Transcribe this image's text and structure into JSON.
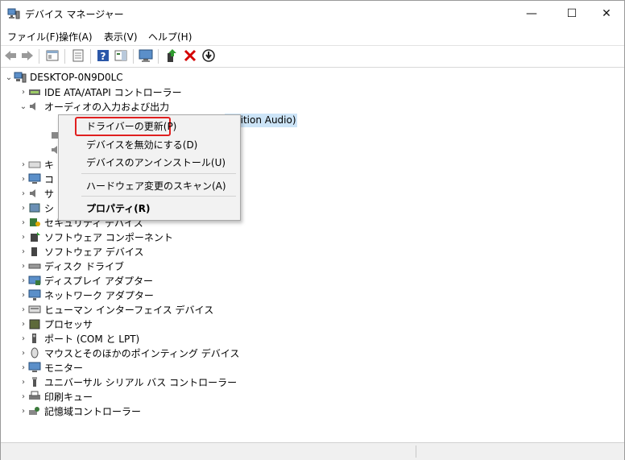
{
  "window": {
    "title": "デバイス マネージャー",
    "minimize": "—",
    "maximize": "☐",
    "close": "✕"
  },
  "menu": [
    "ファイル(F)",
    "操作(A)",
    "表示(V)",
    "ヘルプ(H)"
  ],
  "tree": {
    "root": "DESKTOP-0N9D0LC",
    "items": [
      {
        "label": "IDE ATA/ATAPI コントローラー",
        "icon": "ide-controller-icon",
        "expanded": false
      },
      {
        "label": "オーディオの入力および出力",
        "icon": "audio-icon",
        "expanded": true
      },
      {
        "label": "キ",
        "icon": "keyboard-icon",
        "expanded": false
      },
      {
        "label": "コ",
        "icon": "computer-icon",
        "expanded": false
      },
      {
        "label": "サ",
        "icon": "sound-icon",
        "expanded": false
      },
      {
        "label": "シ",
        "icon": "system-icon",
        "expanded": false
      },
      {
        "label": "セキュリティ デバイス",
        "icon": "security-icon",
        "expanded": false
      },
      {
        "label": "ソフトウェア コンポーネント",
        "icon": "software-component-icon",
        "expanded": false
      },
      {
        "label": "ソフトウェア デバイス",
        "icon": "software-device-icon",
        "expanded": false
      },
      {
        "label": "ディスク ドライブ",
        "icon": "disk-drive-icon",
        "expanded": false
      },
      {
        "label": "ディスプレイ アダプター",
        "icon": "display-adapter-icon",
        "expanded": false
      },
      {
        "label": "ネットワーク アダプター",
        "icon": "network-adapter-icon",
        "expanded": false
      },
      {
        "label": "ヒューマン インターフェイス デバイス",
        "icon": "hid-icon",
        "expanded": false
      },
      {
        "label": "プロセッサ",
        "icon": "processor-icon",
        "expanded": false
      },
      {
        "label": "ポート (COM と LPT)",
        "icon": "port-icon",
        "expanded": false
      },
      {
        "label": "マウスとそのほかのポインティング デバイス",
        "icon": "mouse-icon",
        "expanded": false
      },
      {
        "label": "モニター",
        "icon": "monitor-icon",
        "expanded": false
      },
      {
        "label": "ユニバーサル シリアル バス コントローラー",
        "icon": "usb-icon",
        "expanded": false
      },
      {
        "label": "印刷キュー",
        "icon": "printer-icon",
        "expanded": false
      },
      {
        "label": "記憶域コントローラー",
        "icon": "storage-controller-icon",
        "expanded": false
      }
    ],
    "selected_child_partial": "nition Audio)"
  },
  "context_menu": {
    "update_driver": "ドライバーの更新(P)",
    "disable": "デバイスを無効にする(D)",
    "uninstall": "デバイスのアンインストール(U)",
    "scan": "ハードウェア変更のスキャン(A)",
    "properties": "プロパティ(R)"
  },
  "colors": {
    "highlight_box": "#e02020",
    "selection": "#cce4f7",
    "delete_red": "#d40000",
    "help_blue": "#2b57a8"
  }
}
